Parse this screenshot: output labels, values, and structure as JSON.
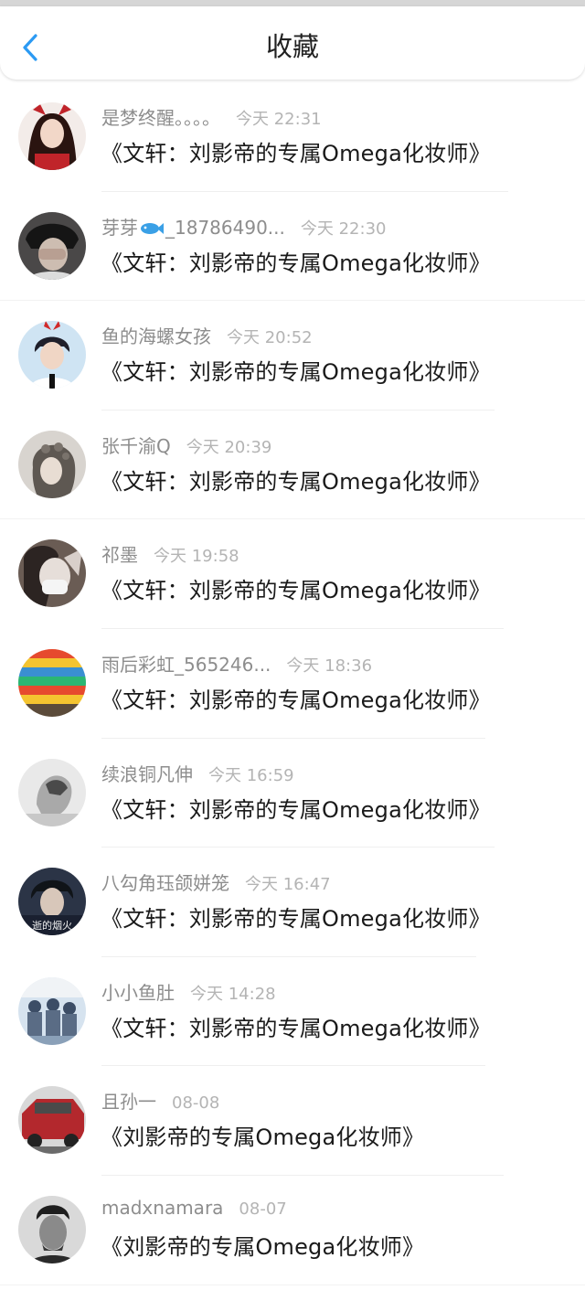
{
  "header": {
    "title": "收藏"
  },
  "items": [
    {
      "name": "是梦终醒。。。。",
      "time": "今天 22:31",
      "work": "《文轩：刘影帝的专属Omega化妆师》",
      "avatar": "avatar-1",
      "colors": [
        "#7a1f1f",
        "#f2d7c8",
        "#2a1410"
      ]
    },
    {
      "name": "芽芽",
      "name_suffix": "_18786490...",
      "time": "今天 22:30",
      "work": "《文轩：刘影帝的专属Omega化妆师》",
      "avatar": "avatar-2",
      "colors": [
        "#3d3b3b",
        "#cdbdb1",
        "#1b1b1b"
      ]
    },
    {
      "name": "鱼的海螺女孩",
      "time": "今天 20:52",
      "work": "《文轩：刘影帝的专属Omega化妆师》",
      "avatar": "avatar-3",
      "colors": [
        "#cfe4f3",
        "#f0d6c5",
        "#1f1f2a"
      ]
    },
    {
      "name": "张千渝Q",
      "time": "今天 20:39",
      "work": "《文轩：刘影帝的专属Omega化妆师》",
      "avatar": "avatar-4",
      "colors": [
        "#b9b4ad",
        "#e8ddd3",
        "#5e5852"
      ]
    },
    {
      "name": "祁墨",
      "time": "今天 19:58",
      "work": "《文轩：刘影帝的专属Omega化妆师》",
      "avatar": "avatar-5",
      "colors": [
        "#6a5c54",
        "#e6ded9",
        "#2c2422"
      ]
    },
    {
      "name": "雨后彩虹_565246...",
      "time": "今天 18:36",
      "work": "《文轩：刘影帝的专属Omega化妆师》",
      "avatar": "avatar-6",
      "colors": [
        "#e64a2e",
        "#f4c430",
        "#3a8fd1"
      ]
    },
    {
      "name": "续浪铜凡伸",
      "time": "今天 16:59",
      "work": "《文轩：刘影帝的专属Omega化妆师》",
      "avatar": "avatar-7",
      "colors": [
        "#e9e9e9",
        "#a9a9a9",
        "#4a4a4a"
      ]
    },
    {
      "name": "八勾角珏颌姘笼",
      "time": "今天 16:47",
      "work": "《文轩：刘影帝的专属Omega化妆师》",
      "avatar": "avatar-8",
      "colors": [
        "#2b3446",
        "#d8c7ba",
        "#101418"
      ]
    },
    {
      "name": "小小鱼肚",
      "time": "今天 14:28",
      "work": "《文轩：刘影帝的专属Omega化妆师》",
      "avatar": "avatar-9",
      "colors": [
        "#d6e3ef",
        "#3c4d66",
        "#f0f3f6"
      ]
    },
    {
      "name": "且孙一",
      "time": "08-08",
      "work": "《刘影帝的专属Omega化妆师》",
      "avatar": "avatar-10",
      "colors": [
        "#b3282d",
        "#6b6b6b",
        "#d8d8d8"
      ]
    },
    {
      "name": "madxnamara",
      "time": "08-07",
      "work": "《刘影帝的专属Omega化妆师》",
      "avatar": "avatar-11",
      "colors": [
        "#8a8a8a",
        "#d9d9d9",
        "#1e1e1e"
      ]
    }
  ],
  "avatar_overlay_text": "逝的烟火",
  "colors": {
    "accent": "#2b9af3",
    "name": "#8d8d8d",
    "time": "#b4b4b4",
    "work": "#1a1a1a"
  }
}
